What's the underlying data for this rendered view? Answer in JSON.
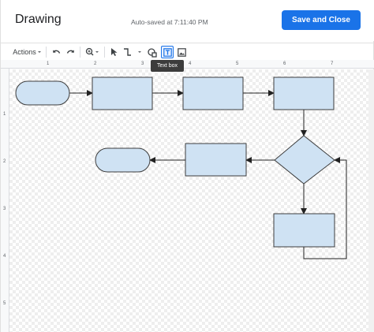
{
  "header": {
    "title": "Drawing",
    "autosave": "Auto-saved at 7:11:40 PM",
    "save_label": "Save and Close"
  },
  "toolbar": {
    "actions_label": "Actions",
    "actions_icon": "caret-down-icon",
    "undo_icon": "undo-icon",
    "redo_icon": "redo-icon",
    "zoom_icon": "zoom-icon",
    "select_icon": "pointer-icon",
    "line_icon": "line-icon",
    "shape_icon": "shape-icon",
    "textbox_icon": "text-box-icon",
    "image_icon": "image-icon",
    "tooltip": "Text box"
  },
  "ruler": {
    "h_labels": [
      "1",
      "2",
      "3",
      "4",
      "5",
      "6",
      "7"
    ],
    "v_labels": [
      "1",
      "2",
      "3",
      "4",
      "5"
    ]
  },
  "colors": {
    "accent": "#1a73e8",
    "shape_fill": "#cfe2f3",
    "shape_stroke": "#3c3c3c"
  },
  "diagram": {
    "shapes": [
      "terminator",
      "process",
      "process",
      "process",
      "decision",
      "process",
      "terminator",
      "process"
    ]
  }
}
